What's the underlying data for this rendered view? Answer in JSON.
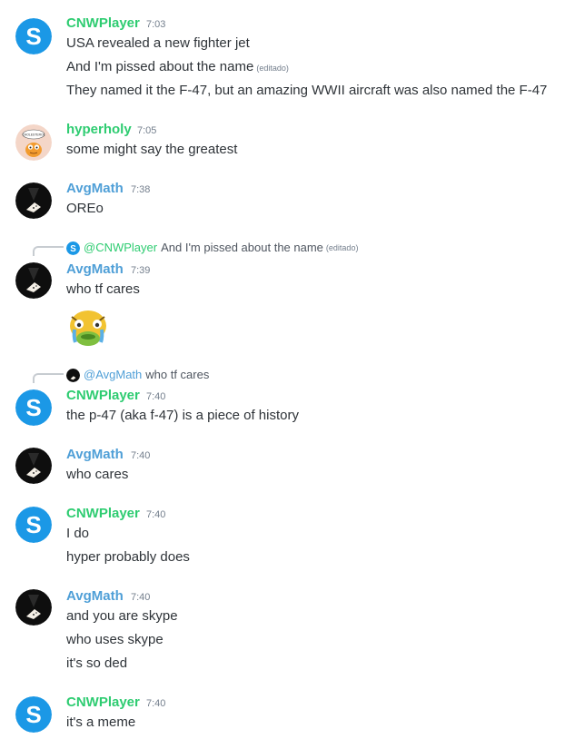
{
  "messages": [
    {
      "author": "CNWPlayer",
      "time": "7:03",
      "lines": [
        "USA revealed a new fighter jet",
        "And I'm pissed about the name",
        "They named it the F-47, but an amazing WWII aircraft was also named the F-47"
      ],
      "edited_tag": "(editado)"
    },
    {
      "author": "hyperholy",
      "time": "7:05",
      "lines": [
        "some might say the greatest"
      ]
    },
    {
      "author": "AvgMath",
      "time": "7:38",
      "lines": [
        "OREo"
      ]
    },
    {
      "author": "AvgMath",
      "time": "7:39",
      "lines": [
        "who tf cares"
      ],
      "reply": {
        "mention": "@CNWPlayer",
        "text": "And I'm pissed about the name",
        "edited_tag": "(editado)"
      }
    },
    {
      "author": "CNWPlayer",
      "time": "7:40",
      "lines": [
        "the p-47 (aka f-47) is a piece of history"
      ],
      "reply": {
        "mention": "@AvgMath",
        "text": "who tf cares"
      }
    },
    {
      "author": "AvgMath",
      "time": "7:40",
      "lines": [
        "who cares"
      ]
    },
    {
      "author": "CNWPlayer",
      "time": "7:40",
      "lines": [
        "I do",
        "hyper probably does"
      ]
    },
    {
      "author": "AvgMath",
      "time": "7:40",
      "lines": [
        "and you are skype",
        "who uses skype",
        "it's so ded"
      ]
    },
    {
      "author": "CNWPlayer",
      "time": "7:40",
      "lines": [
        "it's a meme"
      ]
    }
  ],
  "avatars": {
    "cnwplayer": "skype-logo-icon",
    "hyperholy": "garfield-icon",
    "avgmath": "tuxedo-icon"
  },
  "hyperholy_avatar_text": "CHOLESTEROL",
  "colors": {
    "green": "#2ecc71",
    "blue": "#4f9fd7",
    "skype": "#00aff0"
  }
}
